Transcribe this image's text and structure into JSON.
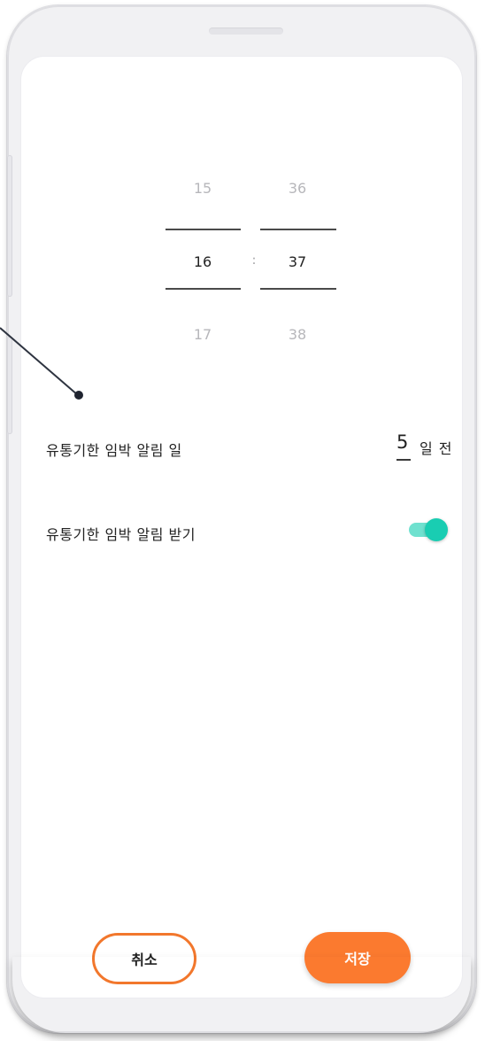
{
  "time_picker": {
    "hours": {
      "prev": "15",
      "selected": "16",
      "next": "17"
    },
    "minutes": {
      "prev": "36",
      "selected": "37",
      "next": "38"
    },
    "separator": ":"
  },
  "settings": {
    "notify_days": {
      "label": "유통기한 임박 알림 일",
      "value": "5",
      "unit": "일 전"
    },
    "notify_toggle": {
      "label": "유통기한 임박 알림 받기",
      "enabled": true
    }
  },
  "actions": {
    "cancel_label": "취소",
    "save_label": "저장"
  },
  "colors": {
    "accent": "#fb7a2f",
    "toggle_on": "#19cdb2",
    "toggle_track": "#6fe1cf"
  }
}
